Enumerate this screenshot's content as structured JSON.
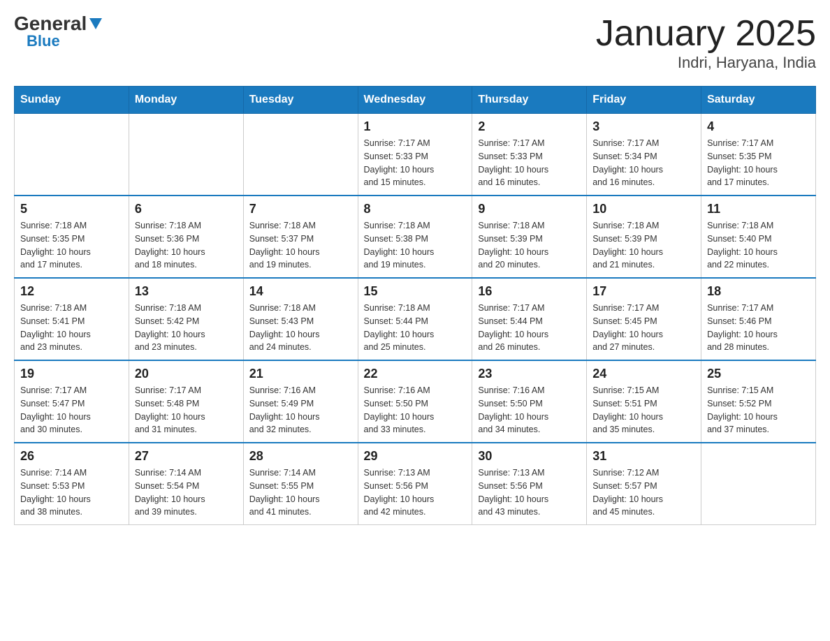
{
  "header": {
    "logo_general": "General",
    "logo_blue": "Blue",
    "month_title": "January 2025",
    "location": "Indri, Haryana, India"
  },
  "days_of_week": [
    "Sunday",
    "Monday",
    "Tuesday",
    "Wednesday",
    "Thursday",
    "Friday",
    "Saturday"
  ],
  "weeks": [
    [
      {
        "day": "",
        "info": ""
      },
      {
        "day": "",
        "info": ""
      },
      {
        "day": "",
        "info": ""
      },
      {
        "day": "1",
        "info": "Sunrise: 7:17 AM\nSunset: 5:33 PM\nDaylight: 10 hours\nand 15 minutes."
      },
      {
        "day": "2",
        "info": "Sunrise: 7:17 AM\nSunset: 5:33 PM\nDaylight: 10 hours\nand 16 minutes."
      },
      {
        "day": "3",
        "info": "Sunrise: 7:17 AM\nSunset: 5:34 PM\nDaylight: 10 hours\nand 16 minutes."
      },
      {
        "day": "4",
        "info": "Sunrise: 7:17 AM\nSunset: 5:35 PM\nDaylight: 10 hours\nand 17 minutes."
      }
    ],
    [
      {
        "day": "5",
        "info": "Sunrise: 7:18 AM\nSunset: 5:35 PM\nDaylight: 10 hours\nand 17 minutes."
      },
      {
        "day": "6",
        "info": "Sunrise: 7:18 AM\nSunset: 5:36 PM\nDaylight: 10 hours\nand 18 minutes."
      },
      {
        "day": "7",
        "info": "Sunrise: 7:18 AM\nSunset: 5:37 PM\nDaylight: 10 hours\nand 19 minutes."
      },
      {
        "day": "8",
        "info": "Sunrise: 7:18 AM\nSunset: 5:38 PM\nDaylight: 10 hours\nand 19 minutes."
      },
      {
        "day": "9",
        "info": "Sunrise: 7:18 AM\nSunset: 5:39 PM\nDaylight: 10 hours\nand 20 minutes."
      },
      {
        "day": "10",
        "info": "Sunrise: 7:18 AM\nSunset: 5:39 PM\nDaylight: 10 hours\nand 21 minutes."
      },
      {
        "day": "11",
        "info": "Sunrise: 7:18 AM\nSunset: 5:40 PM\nDaylight: 10 hours\nand 22 minutes."
      }
    ],
    [
      {
        "day": "12",
        "info": "Sunrise: 7:18 AM\nSunset: 5:41 PM\nDaylight: 10 hours\nand 23 minutes."
      },
      {
        "day": "13",
        "info": "Sunrise: 7:18 AM\nSunset: 5:42 PM\nDaylight: 10 hours\nand 23 minutes."
      },
      {
        "day": "14",
        "info": "Sunrise: 7:18 AM\nSunset: 5:43 PM\nDaylight: 10 hours\nand 24 minutes."
      },
      {
        "day": "15",
        "info": "Sunrise: 7:18 AM\nSunset: 5:44 PM\nDaylight: 10 hours\nand 25 minutes."
      },
      {
        "day": "16",
        "info": "Sunrise: 7:17 AM\nSunset: 5:44 PM\nDaylight: 10 hours\nand 26 minutes."
      },
      {
        "day": "17",
        "info": "Sunrise: 7:17 AM\nSunset: 5:45 PM\nDaylight: 10 hours\nand 27 minutes."
      },
      {
        "day": "18",
        "info": "Sunrise: 7:17 AM\nSunset: 5:46 PM\nDaylight: 10 hours\nand 28 minutes."
      }
    ],
    [
      {
        "day": "19",
        "info": "Sunrise: 7:17 AM\nSunset: 5:47 PM\nDaylight: 10 hours\nand 30 minutes."
      },
      {
        "day": "20",
        "info": "Sunrise: 7:17 AM\nSunset: 5:48 PM\nDaylight: 10 hours\nand 31 minutes."
      },
      {
        "day": "21",
        "info": "Sunrise: 7:16 AM\nSunset: 5:49 PM\nDaylight: 10 hours\nand 32 minutes."
      },
      {
        "day": "22",
        "info": "Sunrise: 7:16 AM\nSunset: 5:50 PM\nDaylight: 10 hours\nand 33 minutes."
      },
      {
        "day": "23",
        "info": "Sunrise: 7:16 AM\nSunset: 5:50 PM\nDaylight: 10 hours\nand 34 minutes."
      },
      {
        "day": "24",
        "info": "Sunrise: 7:15 AM\nSunset: 5:51 PM\nDaylight: 10 hours\nand 35 minutes."
      },
      {
        "day": "25",
        "info": "Sunrise: 7:15 AM\nSunset: 5:52 PM\nDaylight: 10 hours\nand 37 minutes."
      }
    ],
    [
      {
        "day": "26",
        "info": "Sunrise: 7:14 AM\nSunset: 5:53 PM\nDaylight: 10 hours\nand 38 minutes."
      },
      {
        "day": "27",
        "info": "Sunrise: 7:14 AM\nSunset: 5:54 PM\nDaylight: 10 hours\nand 39 minutes."
      },
      {
        "day": "28",
        "info": "Sunrise: 7:14 AM\nSunset: 5:55 PM\nDaylight: 10 hours\nand 41 minutes."
      },
      {
        "day": "29",
        "info": "Sunrise: 7:13 AM\nSunset: 5:56 PM\nDaylight: 10 hours\nand 42 minutes."
      },
      {
        "day": "30",
        "info": "Sunrise: 7:13 AM\nSunset: 5:56 PM\nDaylight: 10 hours\nand 43 minutes."
      },
      {
        "day": "31",
        "info": "Sunrise: 7:12 AM\nSunset: 5:57 PM\nDaylight: 10 hours\nand 45 minutes."
      },
      {
        "day": "",
        "info": ""
      }
    ]
  ]
}
